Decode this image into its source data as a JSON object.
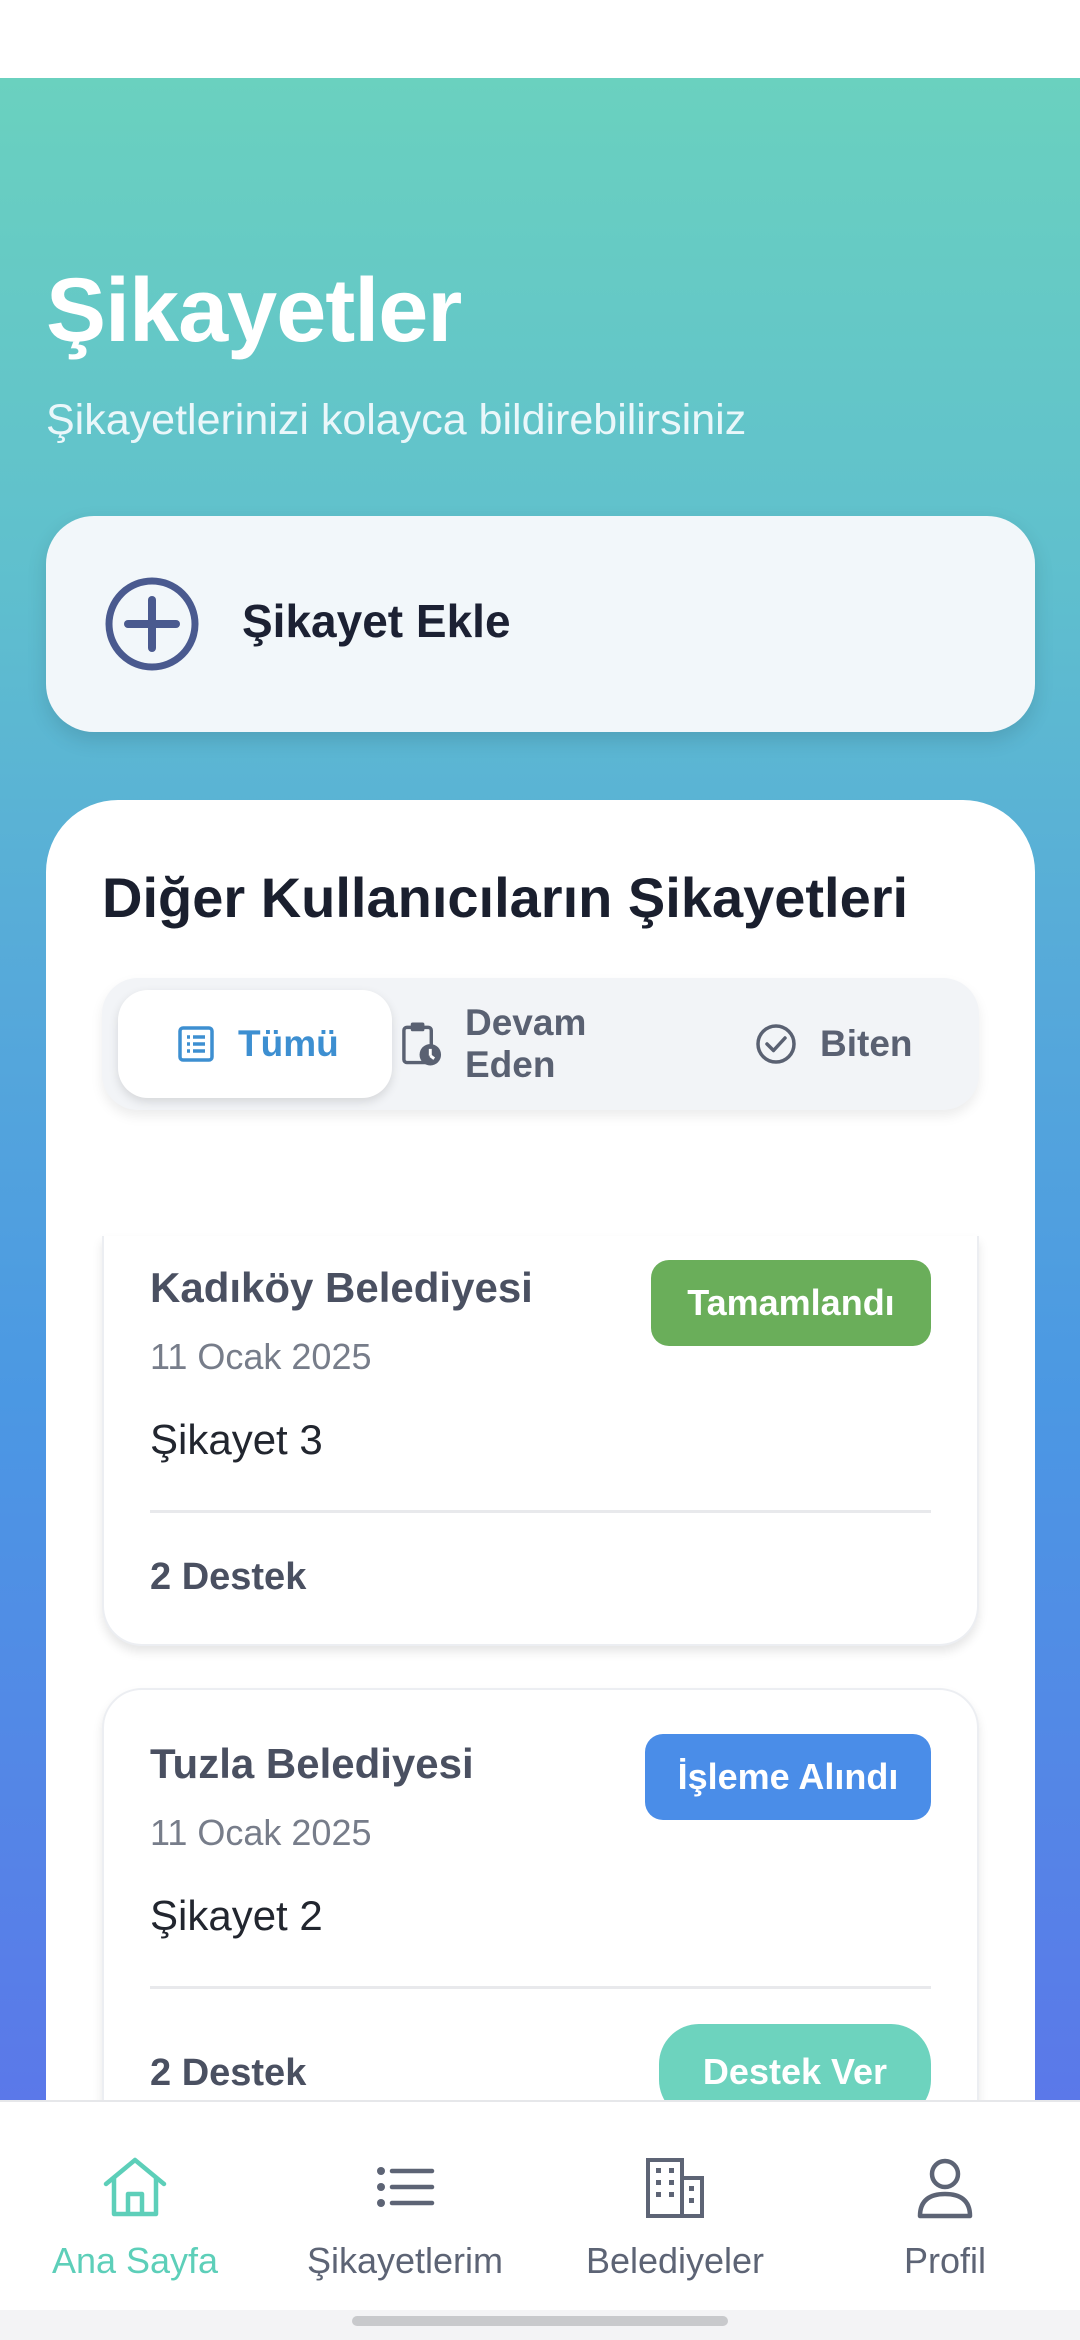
{
  "hero": {
    "title": "Şikayetler",
    "subtitle": "Şikayetlerinizi kolayca bildirebilirsiniz"
  },
  "add_complaint": {
    "label": "Şikayet Ekle",
    "icon": "plus-circle-icon"
  },
  "section": {
    "title": "Diğer Kullanıcıların Şikayetleri"
  },
  "tabs": [
    {
      "label": "Tümü",
      "icon": "list-icon",
      "active": true
    },
    {
      "label": "Devam Eden",
      "icon": "clipboard-clock-icon",
      "active": false
    },
    {
      "label": "Biten",
      "icon": "check-circle-icon",
      "active": false
    }
  ],
  "complaints": [
    {
      "municipality": "Kadıköy Belediyesi",
      "date": "11 Ocak 2025",
      "title": "Şikayet 3",
      "status": "Tamamlandı",
      "support": "2 Destek"
    },
    {
      "municipality": "Tuzla Belediyesi",
      "date": "11 Ocak 2025",
      "title": "Şikayet 2",
      "status": "İşleme Alındı",
      "support": "2 Destek",
      "support_button": "Destek Ver"
    }
  ],
  "nav": [
    {
      "label": "Ana Sayfa",
      "icon": "home-icon",
      "active": true
    },
    {
      "label": "Şikayetlerim",
      "icon": "list-icon",
      "active": false
    },
    {
      "label": "Belediyeler",
      "icon": "building-icon",
      "active": false
    },
    {
      "label": "Profil",
      "icon": "user-icon",
      "active": false
    }
  ],
  "colors": {
    "accent": "#5dcfb9",
    "tab_active": "#3d8fd1",
    "status_completed": "#6aae5a",
    "status_in_progress": "#4a8de8"
  }
}
